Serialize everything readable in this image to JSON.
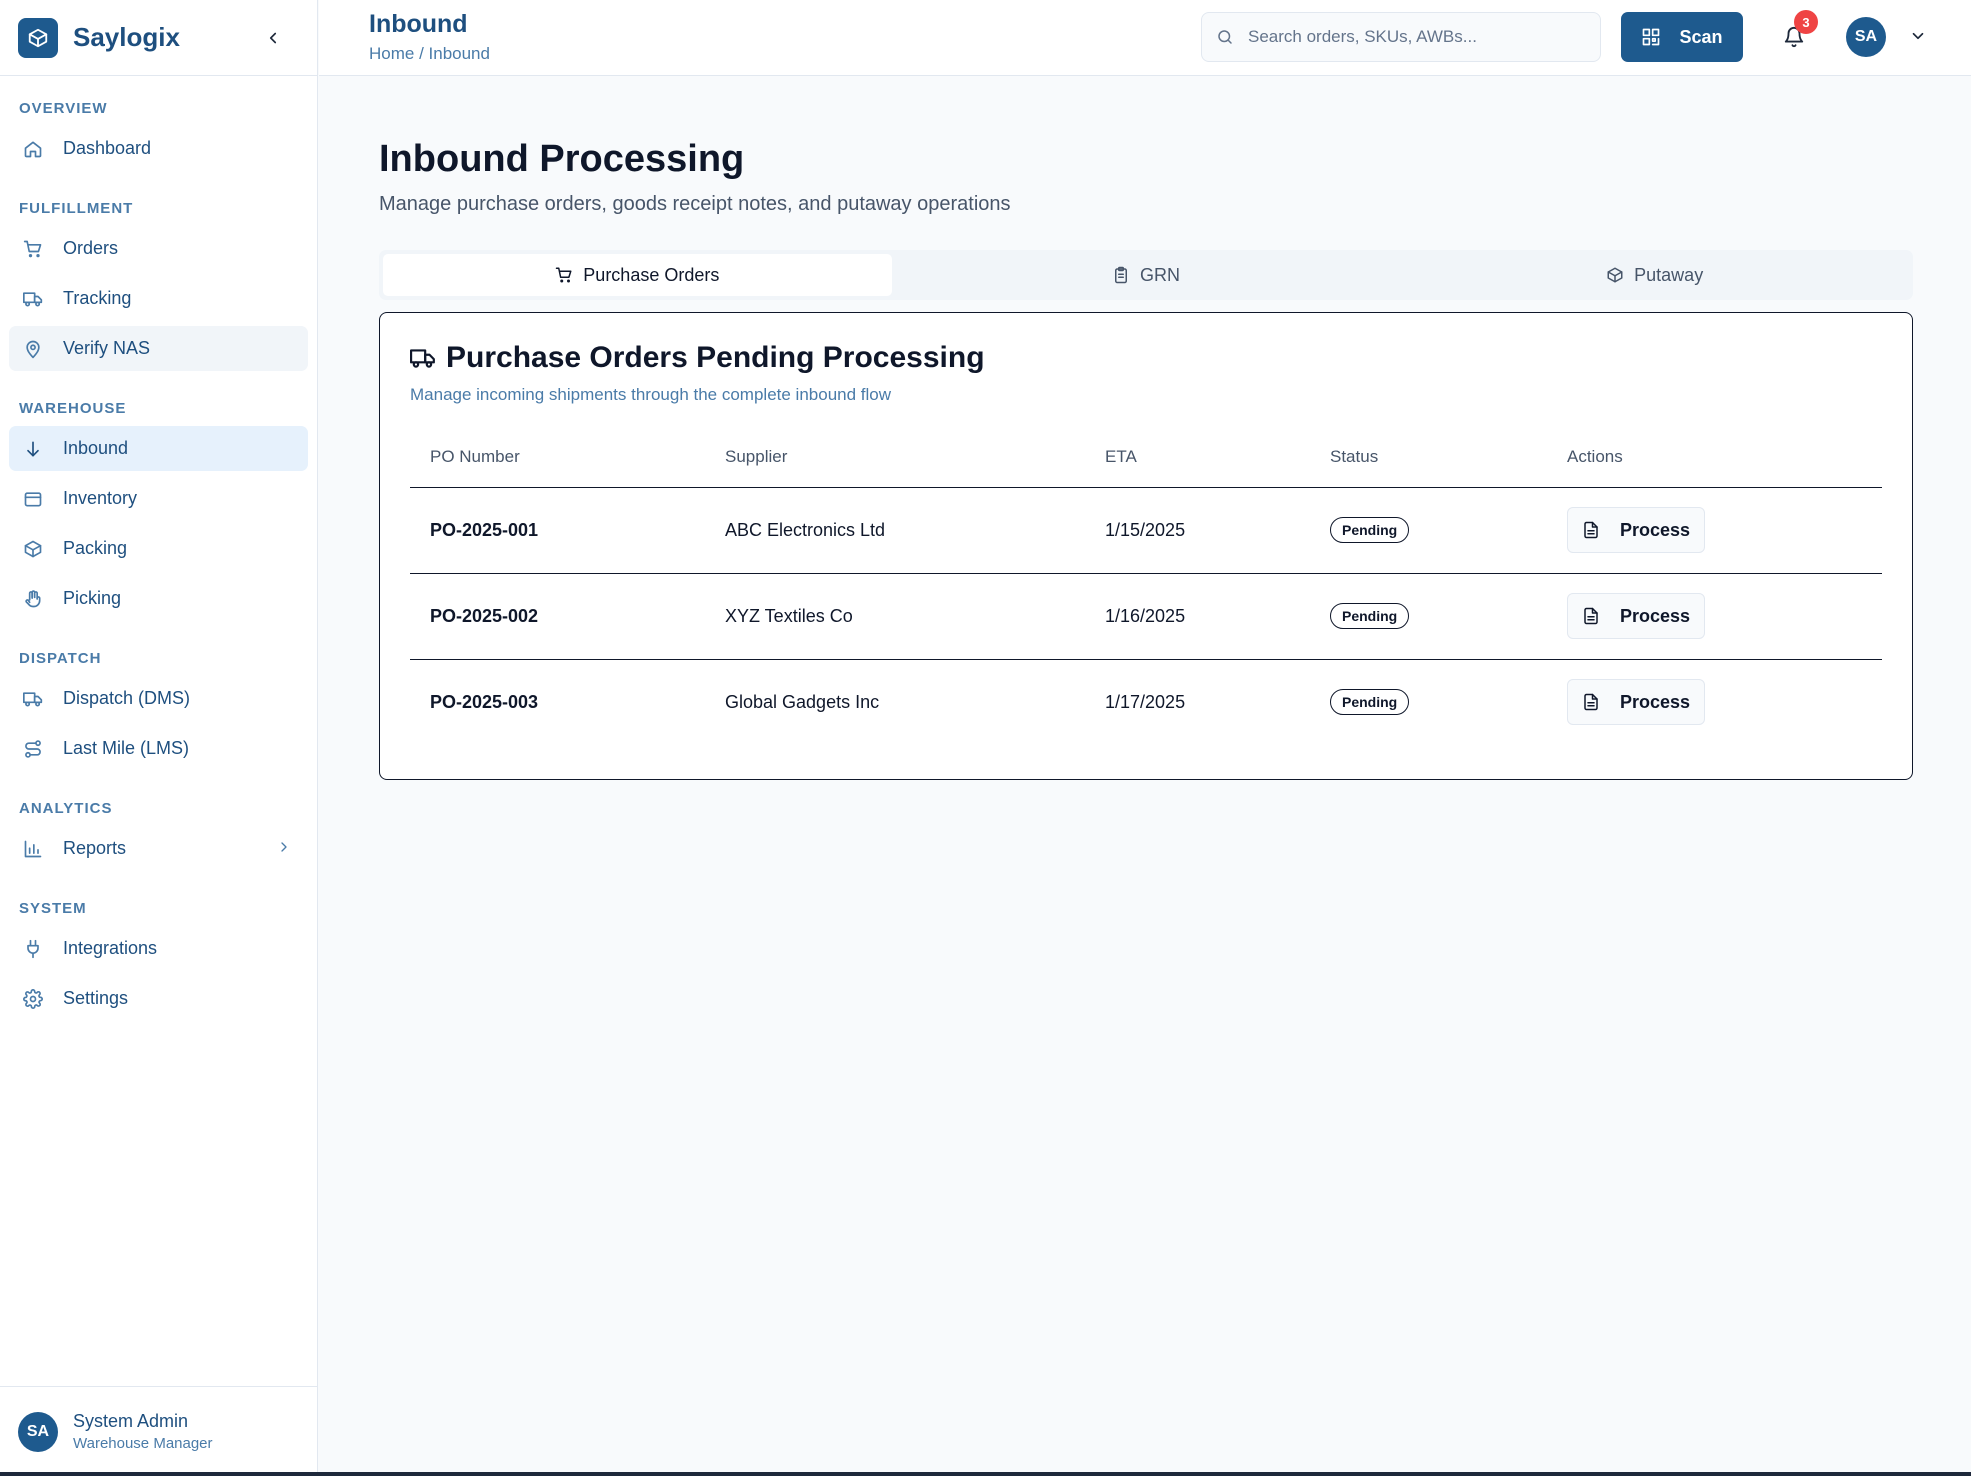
{
  "brand": {
    "name": "Saylogix"
  },
  "sidebar": {
    "sections": [
      {
        "label": "OVERVIEW",
        "items": [
          {
            "label": "Dashboard",
            "icon": "home-icon"
          }
        ]
      },
      {
        "label": "FULFILLMENT",
        "items": [
          {
            "label": "Orders",
            "icon": "cart-icon"
          },
          {
            "label": "Tracking",
            "icon": "truck-icon"
          },
          {
            "label": "Verify NAS",
            "icon": "map-pin-icon"
          }
        ]
      },
      {
        "label": "WAREHOUSE",
        "items": [
          {
            "label": "Inbound",
            "icon": "arrow-down-icon"
          },
          {
            "label": "Inventory",
            "icon": "box-icon"
          },
          {
            "label": "Packing",
            "icon": "package-icon"
          },
          {
            "label": "Picking",
            "icon": "hand-icon"
          }
        ]
      },
      {
        "label": "DISPATCH",
        "items": [
          {
            "label": "Dispatch (DMS)",
            "icon": "truck-icon"
          },
          {
            "label": "Last Mile (LMS)",
            "icon": "route-icon"
          }
        ]
      },
      {
        "label": "ANALYTICS",
        "items": [
          {
            "label": "Reports",
            "icon": "bar-chart-icon"
          }
        ]
      },
      {
        "label": "SYSTEM",
        "items": [
          {
            "label": "Integrations",
            "icon": "plug-icon"
          },
          {
            "label": "Settings",
            "icon": "gear-icon"
          }
        ]
      }
    ]
  },
  "user": {
    "initials": "SA",
    "name": "System Admin",
    "role": "Warehouse Manager"
  },
  "header": {
    "title": "Inbound",
    "breadcrumb": "Home / Inbound",
    "search_placeholder": "Search orders, SKUs, AWBs...",
    "scan_label": "Scan",
    "notification_count": "3"
  },
  "main": {
    "title": "Inbound Processing",
    "subtitle": "Manage purchase orders, goods receipt notes, and putaway operations",
    "tabs": [
      {
        "label": "Purchase Orders",
        "icon": "cart-icon"
      },
      {
        "label": "GRN",
        "icon": "clipboard-icon"
      },
      {
        "label": "Putaway",
        "icon": "package-icon"
      }
    ],
    "card": {
      "title": "Purchase Orders Pending Processing",
      "subtitle": "Manage incoming shipments through the complete inbound flow",
      "columns": [
        "PO Number",
        "Supplier",
        "ETA",
        "Status",
        "Actions"
      ],
      "rows": [
        {
          "po": "PO-2025-001",
          "supplier": "ABC Electronics Ltd",
          "eta": "1/15/2025",
          "status": "Pending",
          "action": "Process"
        },
        {
          "po": "PO-2025-002",
          "supplier": "XYZ Textiles Co",
          "eta": "1/16/2025",
          "status": "Pending",
          "action": "Process"
        },
        {
          "po": "PO-2025-003",
          "supplier": "Global Gadgets Inc",
          "eta": "1/17/2025",
          "status": "Pending",
          "action": "Process"
        }
      ]
    }
  },
  "colors": {
    "primary": "#1e5a8e",
    "sidebar_text": "#1e4f7f",
    "badge_red": "#ef4444"
  }
}
